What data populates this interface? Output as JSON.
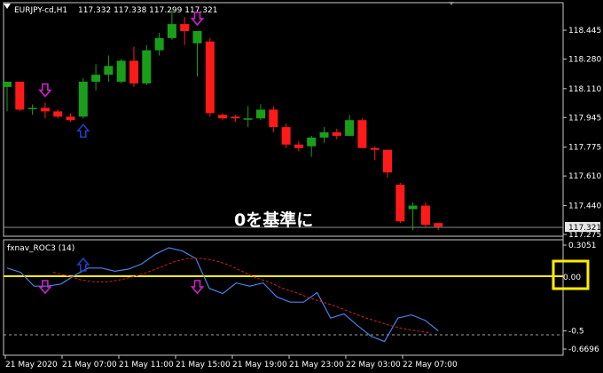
{
  "main": {
    "symbol_label": "EURJPY-cd,H1",
    "ohlc_label": "117.332 117.338 117.299 117.321",
    "price_ticks": [
      "118.445",
      "118.280",
      "118.110",
      "117.945",
      "117.775",
      "117.610",
      "117.440",
      "117.275"
    ],
    "current_price_label": "117.321",
    "candles": [
      {
        "o": 118.12,
        "h": 118.15,
        "l": 117.98,
        "c": 118.15
      },
      {
        "o": 118.15,
        "h": 118.15,
        "l": 117.98,
        "c": 117.99
      },
      {
        "o": 118.0,
        "h": 118.02,
        "l": 117.96,
        "c": 118.0
      },
      {
        "o": 118.0,
        "h": 118.03,
        "l": 117.94,
        "c": 117.98
      },
      {
        "o": 117.98,
        "h": 117.99,
        "l": 117.94,
        "c": 117.95
      },
      {
        "o": 117.95,
        "h": 117.97,
        "l": 117.92,
        "c": 117.93
      },
      {
        "o": 117.95,
        "h": 118.17,
        "l": 117.94,
        "c": 118.15
      },
      {
        "o": 118.15,
        "h": 118.25,
        "l": 118.1,
        "c": 118.19
      },
      {
        "o": 118.19,
        "h": 118.3,
        "l": 118.15,
        "c": 118.24
      },
      {
        "o": 118.15,
        "h": 118.28,
        "l": 118.14,
        "c": 118.27
      },
      {
        "o": 118.27,
        "h": 118.35,
        "l": 118.12,
        "c": 118.14
      },
      {
        "o": 118.14,
        "h": 118.36,
        "l": 118.13,
        "c": 118.33
      },
      {
        "o": 118.33,
        "h": 118.43,
        "l": 118.3,
        "c": 118.4
      },
      {
        "o": 118.4,
        "h": 118.56,
        "l": 118.39,
        "c": 118.48
      },
      {
        "o": 118.48,
        "h": 118.52,
        "l": 118.36,
        "c": 118.44
      },
      {
        "o": 118.37,
        "h": 118.44,
        "l": 118.18,
        "c": 118.44
      },
      {
        "o": 118.38,
        "h": 118.4,
        "l": 117.95,
        "c": 117.97
      },
      {
        "o": 117.96,
        "h": 117.97,
        "l": 117.93,
        "c": 117.94
      },
      {
        "o": 117.95,
        "h": 117.96,
        "l": 117.92,
        "c": 117.94
      },
      {
        "o": 117.94,
        "h": 118.01,
        "l": 117.89,
        "c": 117.94
      },
      {
        "o": 117.94,
        "h": 118.02,
        "l": 117.93,
        "c": 117.99
      },
      {
        "o": 117.99,
        "h": 118.01,
        "l": 117.86,
        "c": 117.89
      },
      {
        "o": 117.89,
        "h": 117.91,
        "l": 117.77,
        "c": 117.79
      },
      {
        "o": 117.79,
        "h": 117.81,
        "l": 117.75,
        "c": 117.77
      },
      {
        "o": 117.78,
        "h": 117.84,
        "l": 117.72,
        "c": 117.83
      },
      {
        "o": 117.83,
        "h": 117.89,
        "l": 117.8,
        "c": 117.86
      },
      {
        "o": 117.86,
        "h": 117.88,
        "l": 117.82,
        "c": 117.84
      },
      {
        "o": 117.84,
        "h": 117.96,
        "l": 117.84,
        "c": 117.93
      },
      {
        "o": 117.93,
        "h": 117.94,
        "l": 117.77,
        "c": 117.77
      },
      {
        "o": 117.77,
        "h": 117.78,
        "l": 117.7,
        "c": 117.76
      },
      {
        "o": 117.76,
        "h": 117.76,
        "l": 117.6,
        "c": 117.63
      },
      {
        "o": 117.56,
        "h": 117.57,
        "l": 117.34,
        "c": 117.35
      },
      {
        "o": 117.42,
        "h": 117.46,
        "l": 117.3,
        "c": 117.44
      },
      {
        "o": 117.44,
        "h": 117.46,
        "l": 117.32,
        "c": 117.33
      },
      {
        "o": 117.34,
        "h": 117.34,
        "l": 117.3,
        "c": 117.32
      }
    ],
    "arrows": [
      {
        "bar": 3,
        "dir": "down",
        "color": "#cc22cc"
      },
      {
        "bar": 6,
        "dir": "up",
        "color": "#1f3fbf"
      },
      {
        "bar": 15,
        "dir": "down",
        "color": "#cc22cc"
      }
    ],
    "overlay_text": "0を基準に"
  },
  "indicator": {
    "label": "fxnav_ROC3 (14)",
    "ticks": [
      "0.3051",
      "0.00",
      "-0.5",
      "-0.6696"
    ],
    "roc_line": [
      0.09,
      0.05,
      -0.08,
      -0.08,
      -0.06,
      0.02,
      0.09,
      0.09,
      0.06,
      0.08,
      0.13,
      0.22,
      0.28,
      0.25,
      0.18,
      -0.1,
      -0.15,
      -0.05,
      -0.08,
      -0.05,
      -0.18,
      -0.23,
      -0.23,
      -0.14,
      -0.38,
      -0.34,
      -0.45,
      -0.55,
      -0.6,
      -0.38,
      -0.35,
      -0.4,
      -0.5
    ],
    "signal_line": [
      0.05,
      0.02,
      -0.02,
      -0.04,
      -0.04,
      -0.02,
      0.01,
      0.05,
      0.1,
      0.15,
      0.18,
      0.18,
      0.16,
      0.12,
      0.06,
      0.0,
      -0.04,
      -0.1,
      -0.14,
      -0.19,
      -0.23,
      -0.27,
      -0.32,
      -0.37,
      -0.41,
      -0.45,
      -0.48,
      -0.5,
      -0.52
    ],
    "arrows": [
      {
        "bar": 3,
        "dir": "down",
        "color": "#cc22cc"
      },
      {
        "bar": 6,
        "dir": "up",
        "color": "#1f3fbf"
      },
      {
        "bar": 15,
        "dir": "down",
        "color": "#cc22cc"
      }
    ],
    "highlight_value": "0.00"
  },
  "time_axis": [
    "21 May 2020",
    "21 May 07:00",
    "21 May 11:00",
    "21 May 15:00",
    "21 May 19:00",
    "21 May 23:00",
    "22 May 03:00",
    "22 May 07:00"
  ],
  "colors": {
    "bull": "#1a9e1a",
    "bear": "#ff1a1a",
    "roc": "#4d7fe6",
    "signal": "#d42020",
    "zero_highlight": "#ffee00",
    "grid": "#c8c8c8"
  }
}
